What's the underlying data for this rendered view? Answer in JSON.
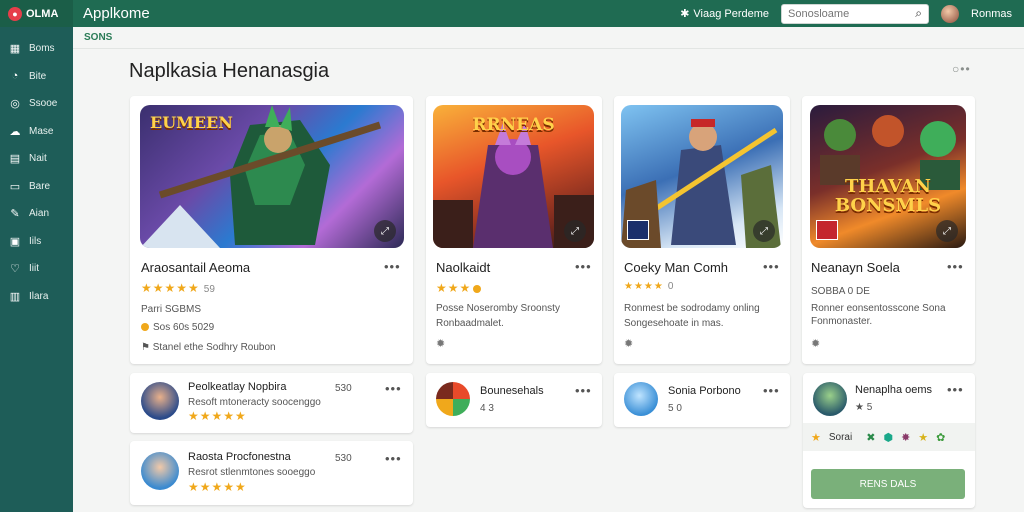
{
  "brand": {
    "name": "OLMA"
  },
  "app": {
    "title": "Applkome"
  },
  "header": {
    "settings_label": "Viaag Perdeme",
    "search_placeholder": "Sonosloame",
    "user_name": "Ronmas"
  },
  "sidebar": {
    "items": [
      {
        "label": "Boms",
        "icon": "grid-icon"
      },
      {
        "label": "Bite",
        "icon": "chat-icon"
      },
      {
        "label": "Ssooe",
        "icon": "target-icon"
      },
      {
        "label": "Mase",
        "icon": "cloud-icon"
      },
      {
        "label": "Nait",
        "icon": "list-icon"
      },
      {
        "label": "Bare",
        "icon": "doc-icon"
      },
      {
        "label": "Aian",
        "icon": "edit-icon"
      },
      {
        "label": "Iils",
        "icon": "calendar-icon"
      },
      {
        "label": "Iiit",
        "icon": "heart-icon"
      },
      {
        "label": "Ilara",
        "icon": "archive-icon"
      }
    ]
  },
  "breadcrumb": "SONS",
  "page": {
    "title": "Naplkasia Henanasgia"
  },
  "cards": [
    {
      "title": "Araosantail Aeoma",
      "art_text": "EUMEEN",
      "rating": "★★★★★",
      "rating_num": "59",
      "line1": "Parri SGBMS",
      "line2": "Sos 60s 5029",
      "line3": "Stanel ethe Sodhry Roubon"
    },
    {
      "title": "Naolkaidt",
      "art_text": "RRNEAS",
      "rating": "★★★",
      "rating_num": "",
      "line1": "Posse Noseromby Sroonsty",
      "line2": "Ronbaadmalet."
    },
    {
      "title": "Coeky Man Comh",
      "art_text": "",
      "rating": "★★★★",
      "rating_num": "0",
      "line1": "Ronmest be sodrodamy onling",
      "line2": "Songesehoate in mas."
    },
    {
      "title": "Neanayn Soela",
      "art_text": "THAVAN BONSMLS",
      "rating": "",
      "rating_num": "",
      "line1": "SOBBA 0 DE",
      "line2": "Ronner eonsentosscone Sona Fonmonaster."
    }
  ],
  "mini_cards": [
    {
      "title": "Peolkeatlay Nopbira",
      "num": "530",
      "subtitle": "Resoft mtoneracty soocenggo",
      "rating": "★★★★★"
    },
    {
      "title": "Bounesehals",
      "num": "",
      "subtitle": "4 3",
      "rating": ""
    },
    {
      "title": "Sonia Porbono",
      "num": "",
      "subtitle": "5 0",
      "rating": ""
    },
    {
      "title": "Nenaplha oems",
      "num": "",
      "subtitle": "★ 5",
      "rating": ""
    },
    {
      "title": "Raosta Procfonestna",
      "num": "530",
      "subtitle": "Resrot stlenmtones sooeggo",
      "rating": "★★★★★"
    }
  ],
  "tray": {
    "label": "Sorai"
  },
  "button": {
    "label": "RENS DALS"
  }
}
